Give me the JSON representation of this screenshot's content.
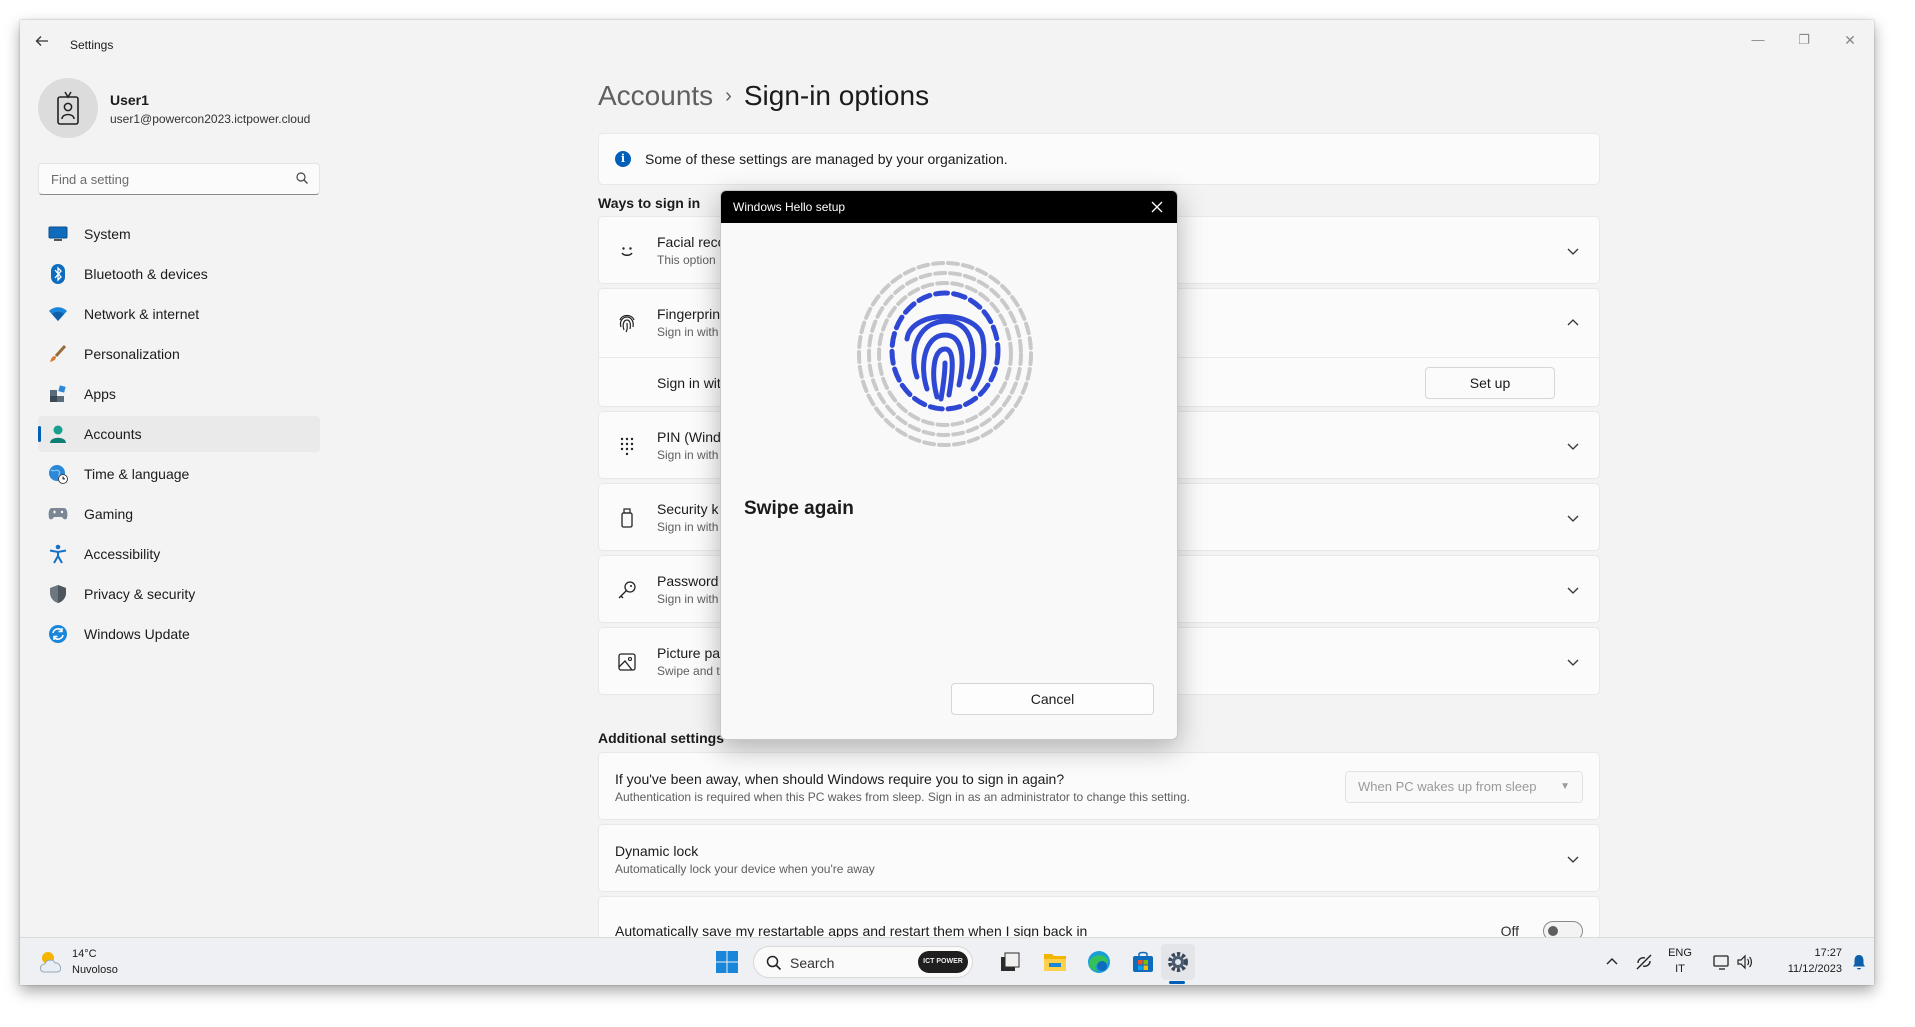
{
  "window": {
    "title": "Settings",
    "controls": {
      "minimize": "—",
      "maximize": "❐",
      "close": "✕"
    }
  },
  "user": {
    "name": "User1",
    "email": "user1@powercon2023.ictpower.cloud"
  },
  "search": {
    "placeholder": "Find a setting"
  },
  "sidebar": {
    "items": [
      {
        "label": "System",
        "icon": "monitor-icon"
      },
      {
        "label": "Bluetooth & devices",
        "icon": "bluetooth-icon"
      },
      {
        "label": "Network & internet",
        "icon": "wifi-icon"
      },
      {
        "label": "Personalization",
        "icon": "brush-icon"
      },
      {
        "label": "Apps",
        "icon": "apps-icon"
      },
      {
        "label": "Accounts",
        "icon": "person-icon",
        "active": true
      },
      {
        "label": "Time & language",
        "icon": "globe-clock-icon"
      },
      {
        "label": "Gaming",
        "icon": "gamepad-icon"
      },
      {
        "label": "Accessibility",
        "icon": "accessibility-icon"
      },
      {
        "label": "Privacy & security",
        "icon": "shield-icon"
      },
      {
        "label": "Windows Update",
        "icon": "update-icon"
      }
    ]
  },
  "breadcrumb": {
    "parent": "Accounts",
    "separator": "›",
    "current": "Sign-in options"
  },
  "info_bar": {
    "icon": "i",
    "text": "Some of these settings are managed by your organization."
  },
  "ways_section": {
    "title": "Ways to sign in",
    "items": [
      {
        "title": "Facial reco",
        "sub": "This option",
        "icon": "smiley-icon"
      },
      {
        "title": "Fingerprin",
        "sub": "Sign in with",
        "icon": "fingerprint-icon",
        "expanded": true,
        "detail_label": "Sign in wit",
        "button": "Set up"
      },
      {
        "title": "PIN (Wind",
        "sub": "Sign in with",
        "icon": "keypad-icon"
      },
      {
        "title": "Security k",
        "sub": "Sign in with",
        "icon": "usb-key-icon"
      },
      {
        "title": "Password",
        "sub": "Sign in with",
        "icon": "key-icon"
      },
      {
        "title": "Picture pa",
        "sub": "Swipe and t",
        "icon": "picture-icon"
      }
    ]
  },
  "additional": {
    "title": "Additional settings",
    "require_signin": {
      "title": "If you've been away, when should Windows require you to sign in again?",
      "sub": "Authentication is required when this PC wakes from sleep. Sign in as an administrator to change this setting.",
      "select_value": "When PC wakes up from sleep"
    },
    "dynamic_lock": {
      "title": "Dynamic lock",
      "sub": "Automatically lock your device when you're away"
    },
    "restart_apps": {
      "title": "Automatically save my restartable apps and restart them when I sign back in",
      "toggle_label": "Off",
      "toggle_on": false
    }
  },
  "dialog": {
    "title": "Windows Hello setup",
    "message": "Swipe again",
    "cancel": "Cancel"
  },
  "taskbar": {
    "weather_temp": "14°C",
    "weather_desc": "Nuvoloso",
    "search_label": "Search",
    "search_badge": "ICT POWER",
    "lang_top": "ENG",
    "lang_bottom": "IT",
    "time": "17:27",
    "date": "11/12/2023"
  },
  "colors": {
    "accent": "#005fb8",
    "dialog_bar": "#000000",
    "fingerprint_blue": "#2f48d4",
    "fingerprint_gray": "#c9c9c9"
  }
}
